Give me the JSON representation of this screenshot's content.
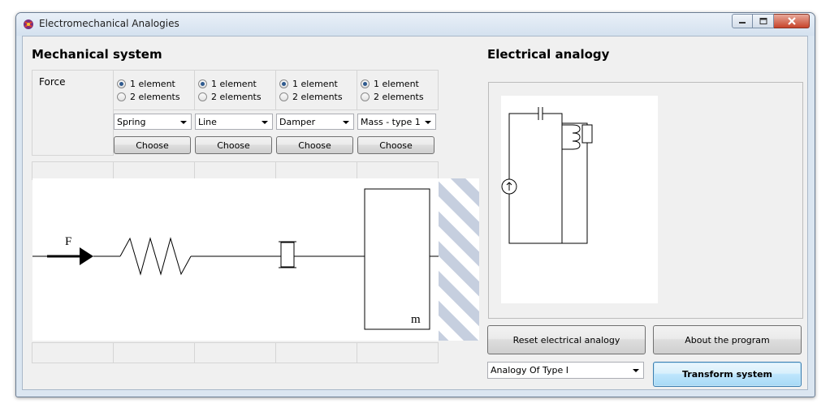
{
  "window": {
    "title": "Electromechanical Analogies"
  },
  "mechanical": {
    "heading": "Mechanical system",
    "force_label": "Force",
    "columns": [
      {
        "opt1": "1 element",
        "opt2": "2 elements",
        "selected": 1,
        "combo": "Spring",
        "choose": "Choose"
      },
      {
        "opt1": "1 element",
        "opt2": "2 elements",
        "selected": 1,
        "combo": "Line",
        "choose": "Choose"
      },
      {
        "opt1": "1 element",
        "opt2": "2 elements",
        "selected": 1,
        "combo": "Damper",
        "choose": "Choose"
      },
      {
        "opt1": "1 element",
        "opt2": "2 elements",
        "selected": 1,
        "combo": "Mass - type 1",
        "choose": "Choose"
      }
    ],
    "diagram": {
      "force_label": "F",
      "mass_label": "m"
    }
  },
  "electrical": {
    "heading": "Electrical analogy",
    "reset_button": "Reset electrical analogy",
    "about_button": "About the program",
    "analogy_select": "Analogy Of Type I",
    "transform_button": "Transform system"
  },
  "colors": {
    "hatch": "#c6cfdf",
    "radio_dot": "#2e5a8e",
    "default_button_border": "#3c7fb1"
  }
}
